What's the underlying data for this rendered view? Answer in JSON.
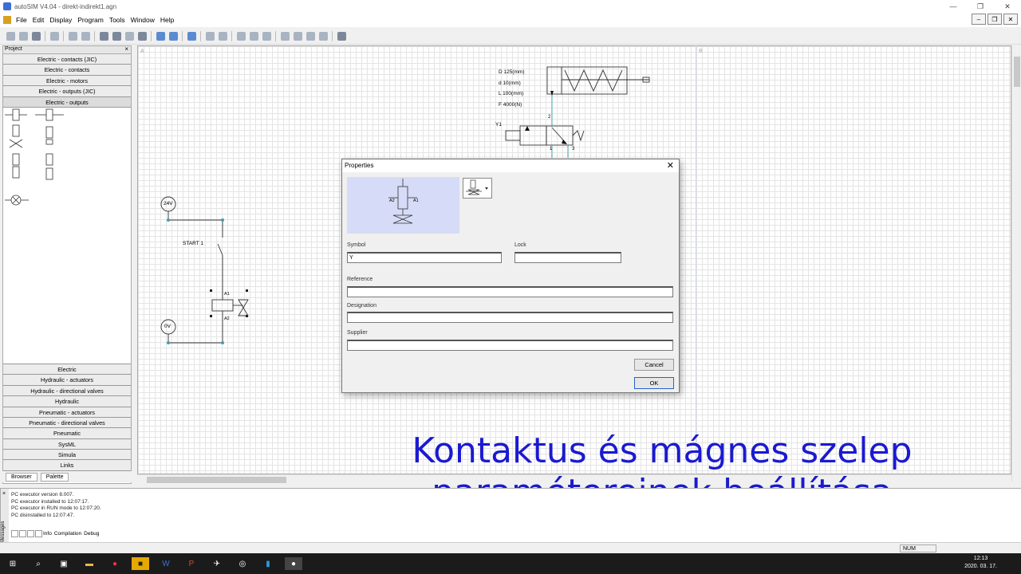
{
  "window": {
    "title": "autoSIM  V4.04 - direkt-indirekt1.agn",
    "controls": [
      "—",
      "❐",
      "✕"
    ]
  },
  "menu": [
    "File",
    "Edit",
    "Display",
    "Program",
    "Tools",
    "Window",
    "Help"
  ],
  "project_panel": {
    "title": "Project",
    "close": "×",
    "top_categories": [
      "Electric - contacts (JIC)",
      "Electric - contacts",
      "Electric - motors",
      "Electric - outputs (JIC)",
      "Electric - outputs"
    ],
    "bottom_categories": [
      "Electric",
      "Hydraulic - actuators",
      "Hydraulic - directional valves",
      "Hydraulic",
      "Pneumatic - actuators",
      "Pneumatic - directional valves",
      "Pneumatic",
      "SysML",
      "Simula",
      "Links"
    ],
    "tabs": [
      "Browser",
      "Palette"
    ]
  },
  "canvas": {
    "margin_a": "A",
    "margin_b": "B",
    "cylinder_params": [
      "D 125(mm)",
      "d 10(mm)",
      "L 100(mm)",
      "F 4000(N)"
    ],
    "valve_label": "Y1",
    "port_2": "2",
    "port_1": "1",
    "port_3": "3",
    "v24": "24V",
    "v0": "0V",
    "start_label": "START 1",
    "coil_a1": "A1",
    "coil_a2": "A2"
  },
  "properties_dialog": {
    "title": "Properties",
    "close": "✕",
    "preview_a1": "A1",
    "preview_a2": "A2",
    "symbol_label": "Symbol",
    "symbol_value": "Y",
    "lock_label": "Lock",
    "lock_value": "",
    "reference_label": "Reference",
    "designation_label": "Designation",
    "supplier_label": "Supplier",
    "cancel": "Cancel",
    "ok": "OK"
  },
  "messages": {
    "side_label": "Messages",
    "lines": [
      "PC executor version 8.007.",
      "PC executor installed to 12:07:17.",
      "PC executor in RUN mode to 12:07:20.",
      "PC disinstalled to 12:07:47."
    ],
    "tabs": [
      "Info",
      "Compilation",
      "Debug"
    ]
  },
  "status": {
    "num": "NUM"
  },
  "caption": {
    "line1": "Kontaktus és mágnes szelep",
    "line2": "paramétereinek beállítása"
  },
  "taskbar": {
    "time": "12:13",
    "date": "2020. 03. 17."
  }
}
